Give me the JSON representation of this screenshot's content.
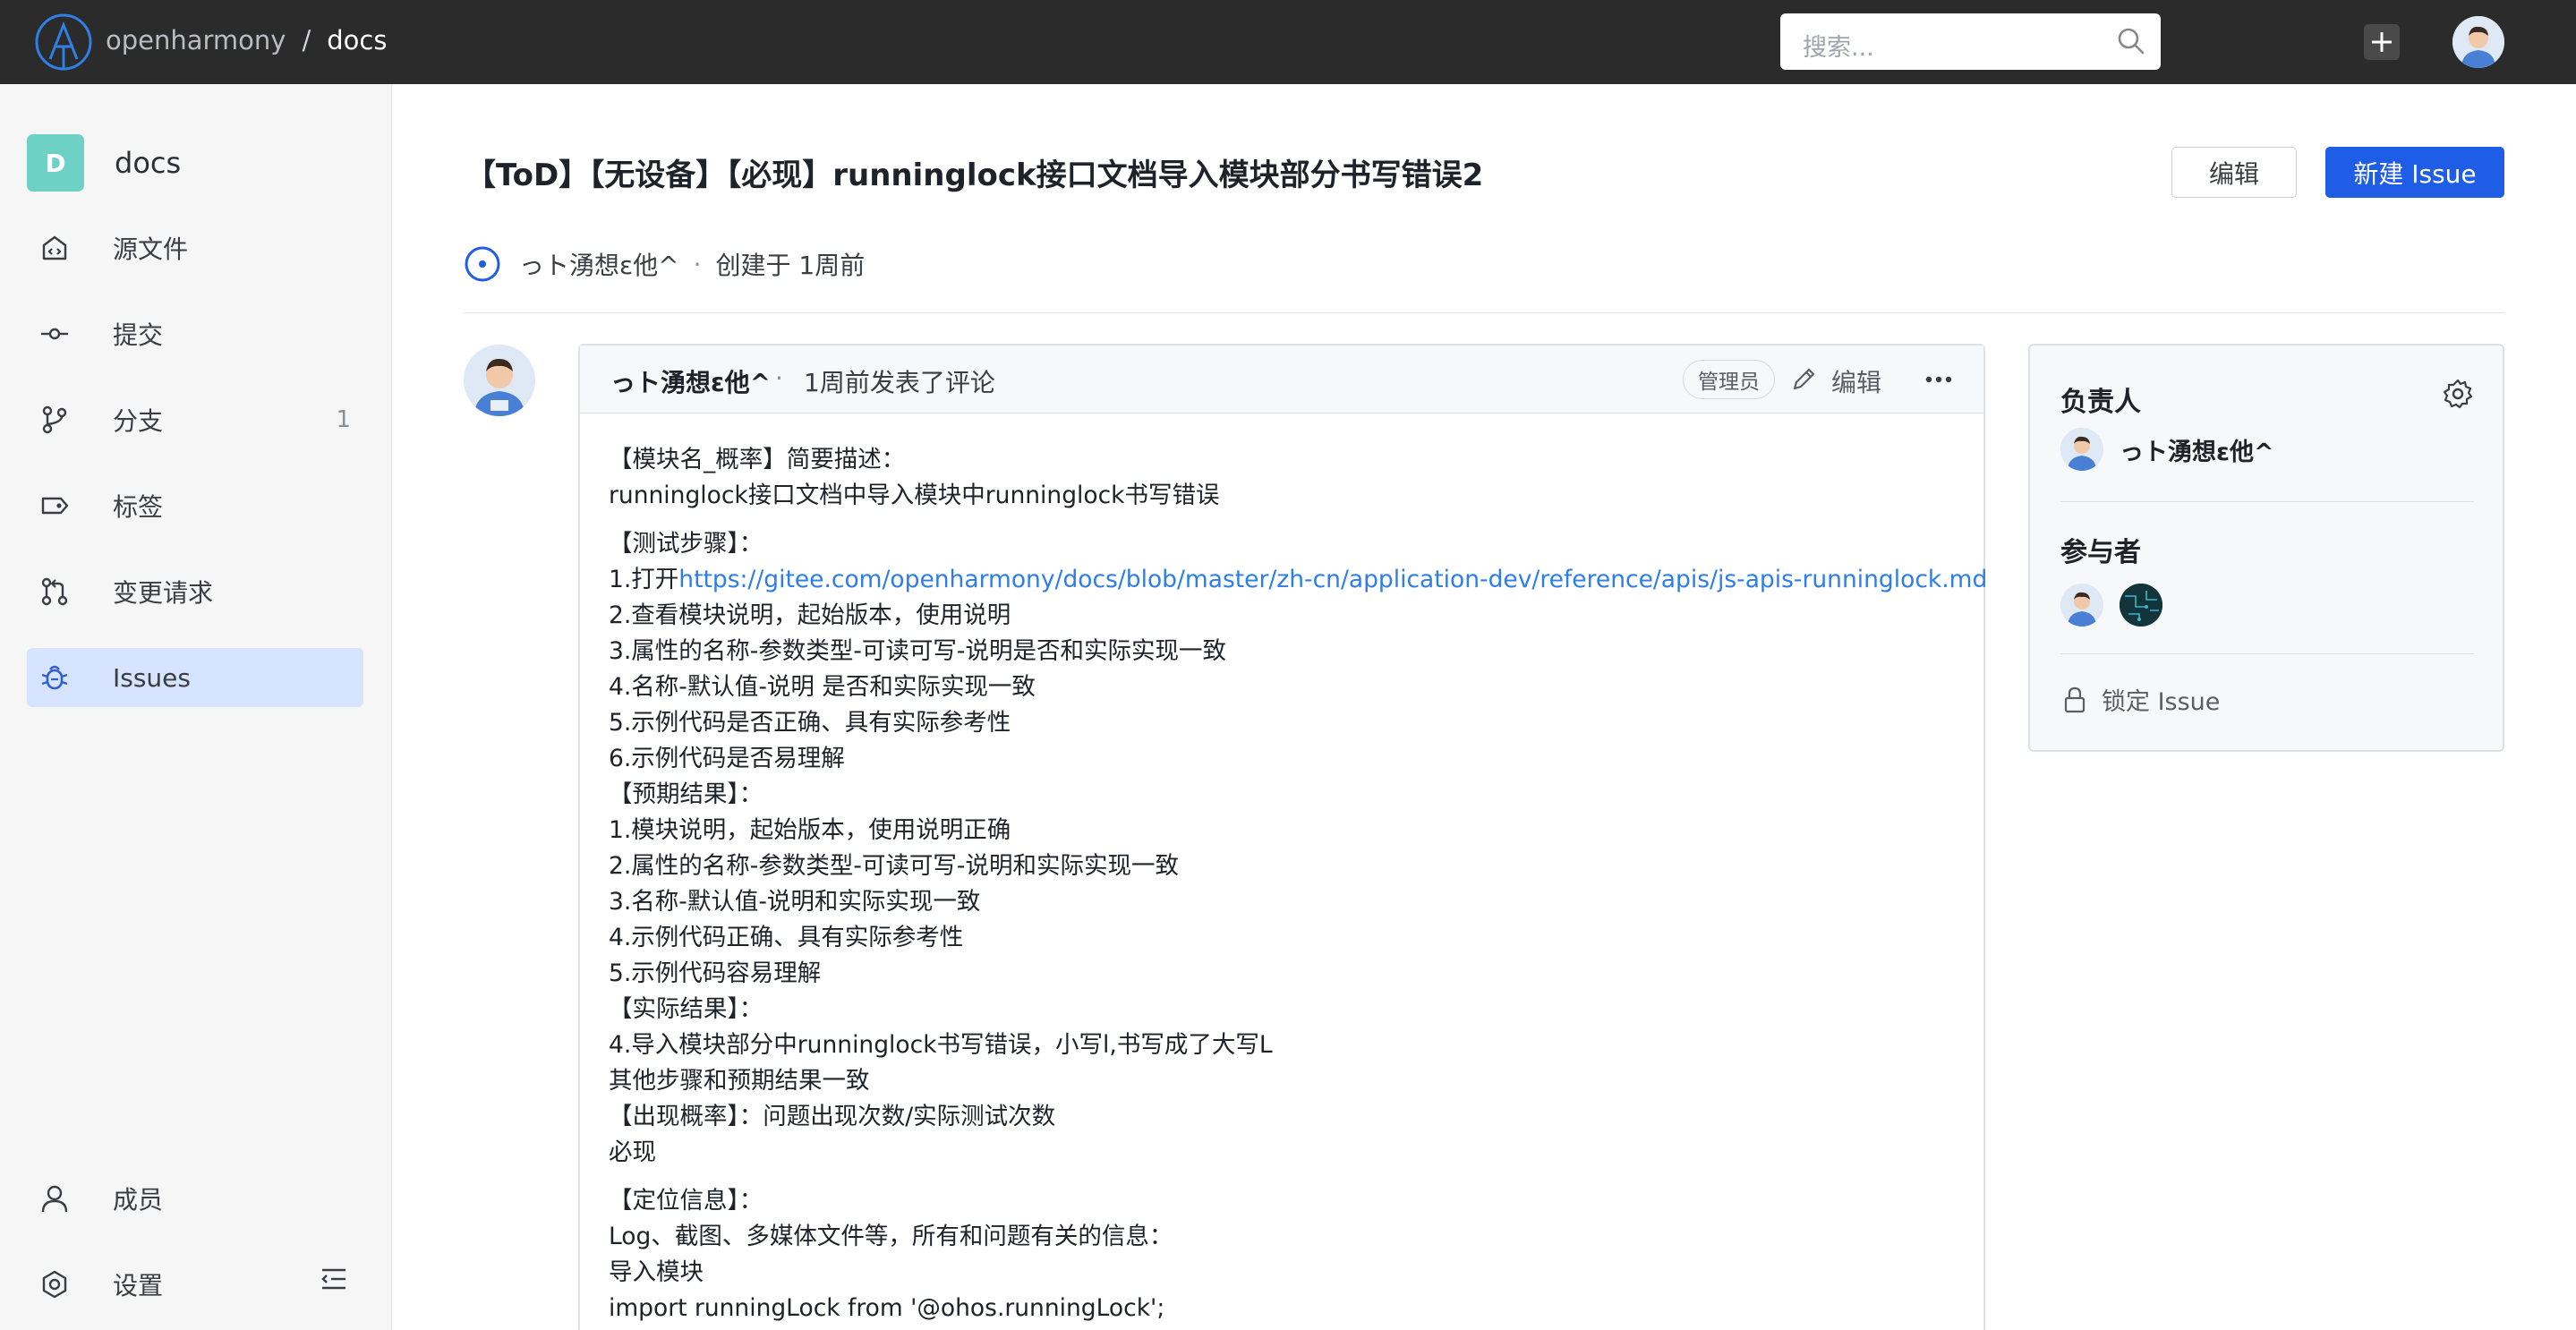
{
  "header": {
    "org": "openharmony",
    "separator": "/",
    "repo": "docs",
    "search_placeholder": "搜索..."
  },
  "sidebar": {
    "repo_badge": "D",
    "repo_name": "docs",
    "items": [
      {
        "label": "源文件",
        "icon": "code-file-icon"
      },
      {
        "label": "提交",
        "icon": "commit-icon"
      },
      {
        "label": "分支",
        "icon": "branch-icon",
        "count": "1"
      },
      {
        "label": "标签",
        "icon": "tag-icon"
      },
      {
        "label": "变更请求",
        "icon": "pull-request-icon"
      },
      {
        "label": "Issues",
        "icon": "bug-icon",
        "active": true
      }
    ],
    "bottom_items": [
      {
        "label": "成员",
        "icon": "user-icon"
      },
      {
        "label": "设置",
        "icon": "settings-icon"
      }
    ]
  },
  "issue": {
    "title": "【ToD】【无设备】【必现】runninglock接口文档导入模块部分书写错误2",
    "edit_label": "编辑",
    "new_issue_label": "新建 Issue",
    "author": "っト湧想ε他^",
    "meta_dot": "·",
    "created": "创建于 1周前"
  },
  "comment": {
    "author": "っト湧想ε他^",
    "dot": "·",
    "time": "1周前发表了评论",
    "role": "管理员",
    "edit_label": "编辑",
    "body": {
      "l1": "【模块名_概率】简要描述：",
      "l2": "runninglock接口文档中导入模块中runninglock书写错误",
      "l3": "【测试步骤】：",
      "l4_prefix": "1.打开",
      "l4_link": "https://gitee.com/openharmony/docs/blob/master/zh-cn/application-dev/reference/apis/js-apis-runninglock.md",
      "l5": "2.查看模块说明，起始版本，使用说明",
      "l6": "3.属性的名称-参数类型-可读可写-说明是否和实际实现一致",
      "l7": "4.名称-默认值-说明 是否和实际实现一致",
      "l8": "5.示例代码是否正确、具有实际参考性",
      "l9": "6.示例代码是否易理解",
      "l10": "【预期结果】：",
      "l11": "1.模块说明，起始版本，使用说明正确",
      "l12": "2.属性的名称-参数类型-可读可写-说明和实际实现一致",
      "l13": "3.名称-默认值-说明和实际实现一致",
      "l14": "4.示例代码正确、具有实际参考性",
      "l15": "5.示例代码容易理解",
      "l16": "【实际结果】：",
      "l17": "4.导入模块部分中runninglock书写错误，小写l,书写成了大写L",
      "l18": "其他步骤和预期结果一致",
      "l19": "【出现概率】：问题出现次数/实际测试次数",
      "l20": "必现",
      "l21": "【定位信息】：",
      "l22": "Log、截图、多媒体文件等，所有和问题有关的信息：",
      "l23": "导入模块",
      "l24": "import runningLock from '@ohos.runningLock';"
    }
  },
  "side": {
    "assignee_heading": "负责人",
    "assignee_name": "っト湧想ε他^",
    "participants_heading": "参与者",
    "lock_label": "锁定 Issue"
  },
  "colors": {
    "topbar": "#2b2b2b",
    "primary": "#1f5de6",
    "link": "#2d7ee8",
    "active_nav": "#d6e4ff",
    "repo_badge": "#6dd1c6"
  }
}
